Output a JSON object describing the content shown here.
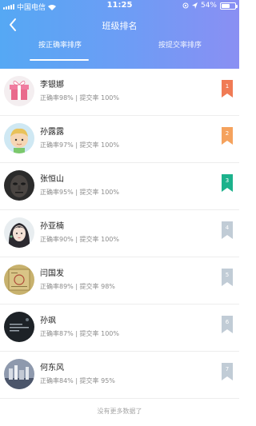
{
  "status": {
    "carrier": "中国电信",
    "time": "11:25",
    "battery": "54%"
  },
  "nav": {
    "title": "班级排名"
  },
  "tabs": [
    {
      "label": "按正确率排序",
      "active": true
    },
    {
      "label": "按提交率排序",
      "active": false
    }
  ],
  "colors": {
    "header_start": "#55a8f4",
    "header_end": "#8a8ff3",
    "rank_1": "#f07b55",
    "rank_2": "#f5a25d",
    "rank_3": "#1cb28c",
    "rank_other": "#c1ccd6"
  },
  "rows": [
    {
      "name": "李银娜",
      "accuracy": "正确率98% | 提交率 100%",
      "rank": "1",
      "avatar": "gift-box-avatar"
    },
    {
      "name": "孙露露",
      "accuracy": "正确率97% | 提交率 100%",
      "rank": "2",
      "avatar": "cartoon-boy-avatar"
    },
    {
      "name": "张恒山",
      "accuracy": "正确率95% | 提交率 100%",
      "rank": "3",
      "avatar": "dark-face-avatar"
    },
    {
      "name": "孙亚楠",
      "accuracy": "正确率90% | 提交率 100%",
      "rank": "4",
      "avatar": "anime-girl-avatar"
    },
    {
      "name": "闫国发",
      "accuracy": "正确率89% | 提交率 98%",
      "rank": "5",
      "avatar": "vintage-paper-avatar"
    },
    {
      "name": "孙飒",
      "accuracy": "正确率87% | 提交率 100%",
      "rank": "6",
      "avatar": "night-text-avatar"
    },
    {
      "name": "何东风",
      "accuracy": "正确率84% | 提交率 95%",
      "rank": "7",
      "avatar": "city-skyline-avatar"
    }
  ],
  "footer": {
    "text": "没有更多数据了"
  }
}
